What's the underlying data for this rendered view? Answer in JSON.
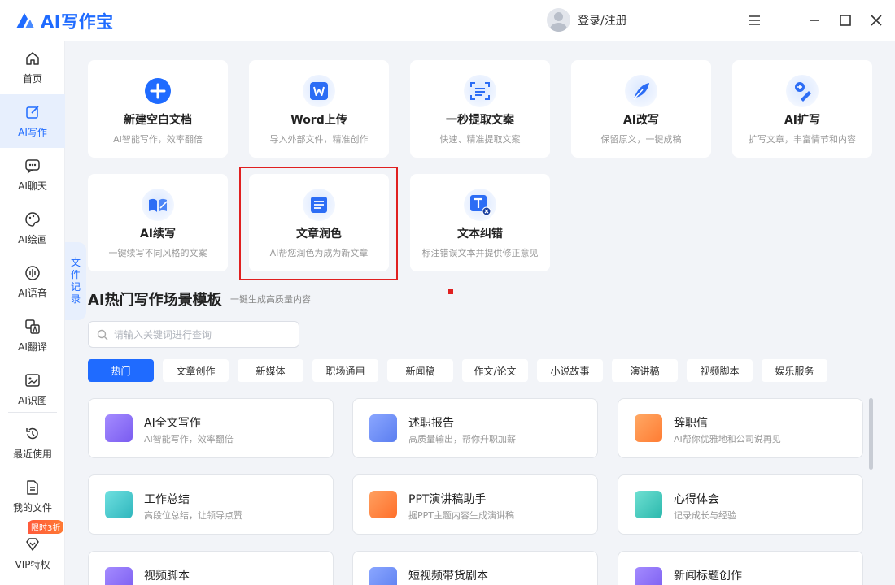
{
  "app": {
    "logo_text": "AI写作宝",
    "brand_color": "#1f6bff"
  },
  "user": {
    "login_label": "登录/注册"
  },
  "window_controls": [
    "menu-icon",
    "minimize-icon",
    "maximize-icon",
    "close-icon"
  ],
  "sidebar": {
    "items": [
      {
        "label": "首页",
        "icon": "home-icon"
      },
      {
        "label": "AI写作",
        "icon": "edit-icon",
        "active": true
      },
      {
        "label": "AI聊天",
        "icon": "chat-icon"
      },
      {
        "label": "AI绘画",
        "icon": "palette-icon"
      },
      {
        "label": "AI语音",
        "icon": "voice-icon"
      },
      {
        "label": "AI翻译",
        "icon": "translate-icon"
      },
      {
        "label": "AI识图",
        "icon": "image-icon"
      },
      {
        "label": "最近使用",
        "icon": "history-icon"
      },
      {
        "label": "我的文件",
        "icon": "file-icon"
      },
      {
        "label": "VIP特权",
        "icon": "diamond-icon"
      }
    ],
    "discount_badge": "限时3折"
  },
  "file_record_tab": {
    "chars": [
      "文",
      "件",
      "记",
      "录"
    ]
  },
  "tools": [
    {
      "title": "新建空白文档",
      "subtitle": "AI智能写作，效率翻倍",
      "icon": "plus-icon"
    },
    {
      "title": "Word上传",
      "subtitle": "导入外部文件，精准创作",
      "icon": "word-icon"
    },
    {
      "title": "一秒提取文案",
      "subtitle": "快速、精准提取文案",
      "icon": "scan-icon"
    },
    {
      "title": "AI改写",
      "subtitle": "保留原义，一键成稿",
      "icon": "feather-icon"
    },
    {
      "title": "AI扩写",
      "subtitle": "扩写文章，丰富情节和内容",
      "icon": "expand-icon"
    },
    {
      "title": "AI续写",
      "subtitle": "一键续写不同风格的文案",
      "icon": "continue-icon"
    },
    {
      "title": "文章润色",
      "subtitle": "AI帮您润色为成为新文章",
      "icon": "polish-icon"
    },
    {
      "title": "文本纠错",
      "subtitle": "标注错误文本并提供修正意见",
      "icon": "correct-icon"
    }
  ],
  "templates_section": {
    "title": "AI热门写作场景模板",
    "subtitle": "一键生成高质量内容",
    "search_placeholder": "请输入关键词进行查询",
    "chips": [
      "热门",
      "文章创作",
      "新媒体",
      "职场通用",
      "新闻稿",
      "作文/论文",
      "小说故事",
      "演讲稿",
      "视频脚本",
      "娱乐服务"
    ],
    "active_chip": "热门",
    "items": [
      {
        "name": "AI全文写作",
        "desc": "AI智能写作，效率翻倍",
        "color": "#8a6cf5"
      },
      {
        "name": "述职报告",
        "desc": "高质量输出，帮你升职加薪",
        "color": "#6b8cf7"
      },
      {
        "name": "辞职信",
        "desc": "AI帮你优雅地和公司说再见",
        "color": "#ff8a3d"
      },
      {
        "name": "工作总结",
        "desc": "高段位总结，让领导点赞",
        "color": "#3cc4c9"
      },
      {
        "name": "PPT演讲稿助手",
        "desc": "据PPT主题内容生成演讲稿",
        "color": "#ff7d33"
      },
      {
        "name": "心得体会",
        "desc": "记录成长与经验",
        "color": "#35c0b8"
      },
      {
        "name": "视频脚本",
        "desc": "",
        "color": "#8a6cf5"
      },
      {
        "name": "短视频带货剧本",
        "desc": "",
        "color": "#5b86f0"
      },
      {
        "name": "新闻标题创作",
        "desc": "",
        "color": "#8a6cf5"
      }
    ]
  }
}
